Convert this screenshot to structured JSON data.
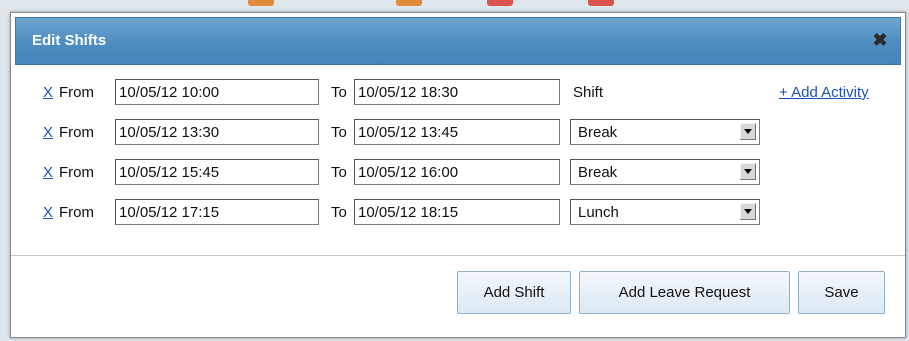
{
  "dialog": {
    "title": "Edit Shifts",
    "close_icon": "close-icon"
  },
  "shifts": [
    {
      "remove": "X",
      "from_label": "From",
      "from": "10/05/12 10:00",
      "to_label": "To",
      "to": "10/05/12 18:30",
      "type": "Shift",
      "type_is_select": false
    },
    {
      "remove": "X",
      "from_label": "From",
      "from": "10/05/12 13:30",
      "to_label": "To",
      "to": "10/05/12 13:45",
      "type": "Break",
      "type_is_select": true
    },
    {
      "remove": "X",
      "from_label": "From",
      "from": "10/05/12 15:45",
      "to_label": "To",
      "to": "10/05/12 16:00",
      "type": "Break",
      "type_is_select": true
    },
    {
      "remove": "X",
      "from_label": "From",
      "from": "10/05/12 17:15",
      "to_label": "To",
      "to": "10/05/12 18:15",
      "type": "Lunch",
      "type_is_select": true
    }
  ],
  "add_activity_label": "+ Add Activity",
  "buttons": {
    "add_shift": "Add Shift",
    "add_leave_request": "Add Leave Request",
    "save": "Save"
  },
  "colors": {
    "titlebar": "#4e8cc0",
    "link": "#1d52b8",
    "button_bg": "#dde9f3"
  }
}
